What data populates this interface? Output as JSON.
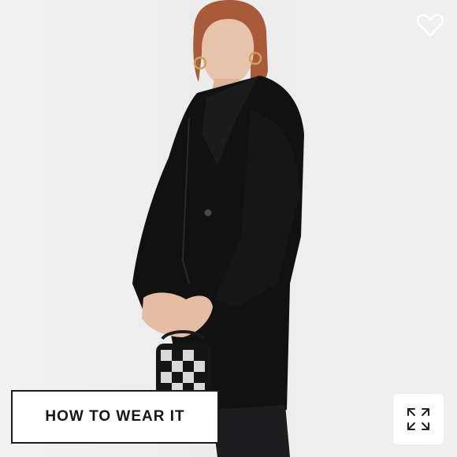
{
  "product_image": {
    "alt": "",
    "icons": {
      "favorite": "heart-outline-icon",
      "zoom": "expand-arrows-icon"
    }
  },
  "actions": {
    "how_to_wear_label": "HOW TO WEAR IT"
  },
  "colors": {
    "background": "#ededee",
    "coat": "#111112",
    "button_border": "#1b1b1b",
    "icon": "#ffffff"
  }
}
